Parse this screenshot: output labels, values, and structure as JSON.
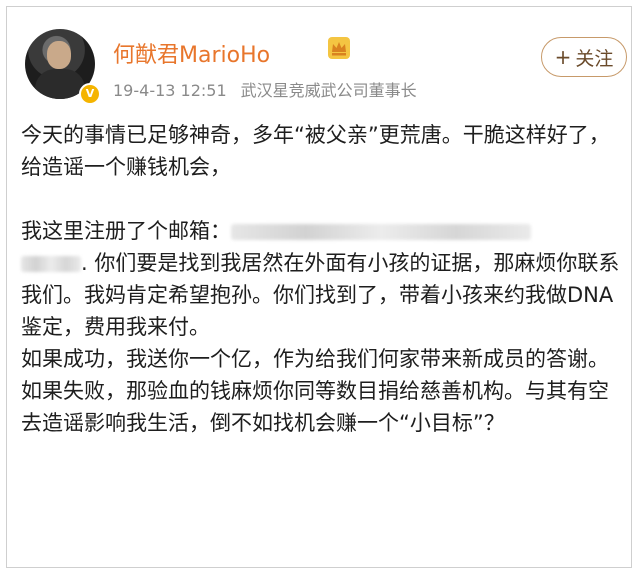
{
  "post": {
    "author": "何猷君MarioHo",
    "timestamp": "19-4-13 12:51",
    "subtitle": "武汉星竞威武公司董事长",
    "follow_label": "关注",
    "follow_plus": "+",
    "paragraphs": [
      "今天的事情已足够神奇，多年“被父亲”更荒唐。干脆这样好了，给造谣一个赚钱机会，",
      "我这里注册了个邮箱：",
      ". 你们要是找到我居然在外面有小孩的证据，那麻烦你联系我们。我妈肯定希望抱孙。你们找到了，带着小孩来约我做DNA鉴定，费用我来付。",
      "如果成功，我送你一个亿，作为给我们何家带来新成员的答谢。",
      "如果失败，那验血的钱麻烦你同等数目捐给慈善机构。与其有空去造谣影响我生活，倒不如找机会赚一个“小目标”？"
    ]
  },
  "icons": {
    "crown": "crown-icon",
    "verified": "verified-badge-icon",
    "avatar": "avatar"
  },
  "colors": {
    "username": "#e8762c",
    "meta": "#8a8a8a",
    "follow_border": "#c79a6a",
    "text": "#1e1e1e"
  }
}
